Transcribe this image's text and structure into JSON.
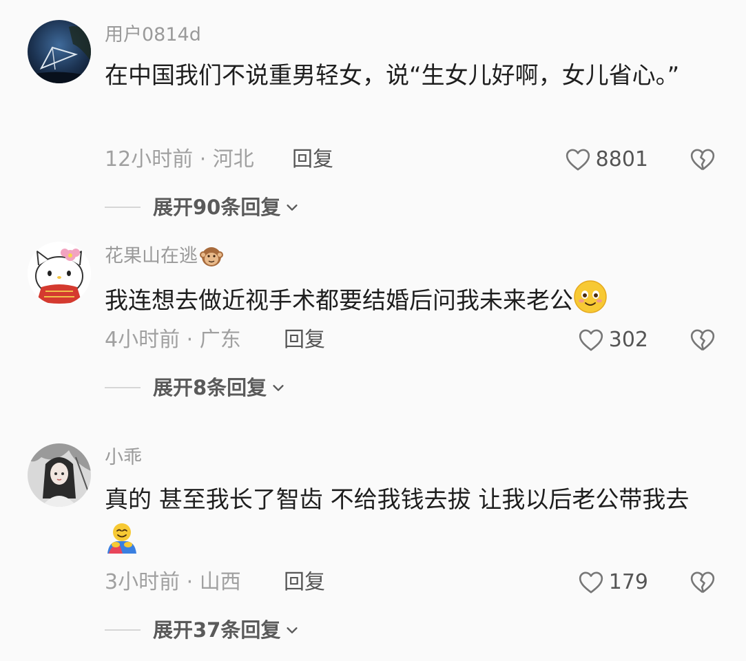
{
  "comments": [
    {
      "username": "用户0814d",
      "text": "在中国我们不说重男轻女，说“生女儿好啊，女儿省心。”",
      "time": "12小时前 · 河北",
      "reply_label": "回复",
      "likes": "8801",
      "expand_label": "展开90条回复"
    },
    {
      "username": "花果山在逃",
      "username_emoji": "monkey-emoji",
      "text": "我连想去做近视手术都要结婚后问我未来老公",
      "text_emoji": "smile-emoji",
      "time": "4小时前 · 广东",
      "reply_label": "回复",
      "likes": "302",
      "expand_label": "展开8条回复"
    },
    {
      "username": "小乖",
      "text": "真的 甚至我长了智齿 不给我钱去拔 让我以后老公带我去",
      "text_emoji": "hug-emoji",
      "time": "3小时前 · 山西",
      "reply_label": "回复",
      "likes": "179",
      "expand_label": "展开37条回复"
    }
  ]
}
